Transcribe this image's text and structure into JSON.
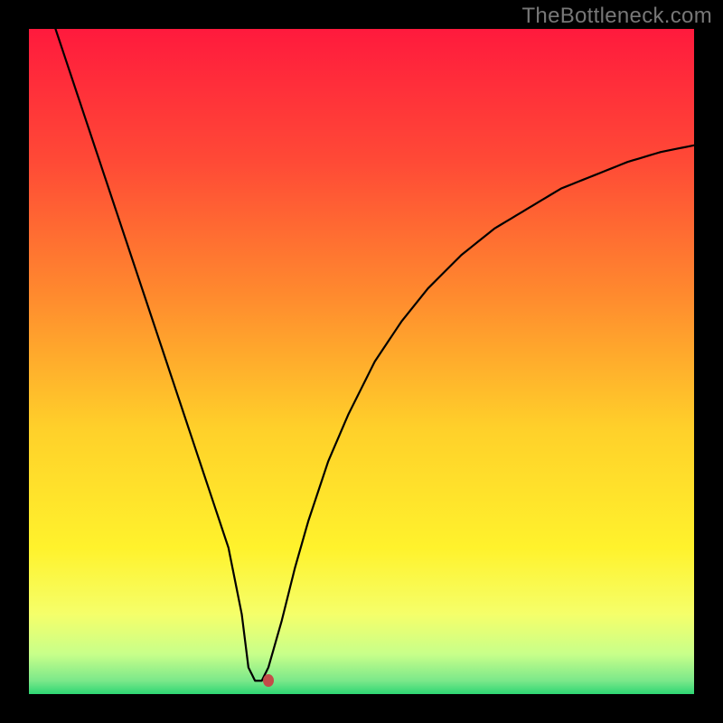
{
  "watermark": "TheBottleneck.com",
  "colors": {
    "frame_bg": "#000000",
    "gradient_stops": [
      {
        "offset": 0.0,
        "color": "#ff1a3d"
      },
      {
        "offset": 0.2,
        "color": "#ff4a36"
      },
      {
        "offset": 0.4,
        "color": "#ff8a2e"
      },
      {
        "offset": 0.6,
        "color": "#ffd02a"
      },
      {
        "offset": 0.78,
        "color": "#fff22c"
      },
      {
        "offset": 0.88,
        "color": "#f5ff6a"
      },
      {
        "offset": 0.94,
        "color": "#c8ff8a"
      },
      {
        "offset": 0.98,
        "color": "#7be88a"
      },
      {
        "offset": 1.0,
        "color": "#2ed673"
      }
    ],
    "curve_stroke": "#000000",
    "marker_fill": "#c44c49"
  },
  "chart_data": {
    "type": "line",
    "title": "",
    "xlabel": "",
    "ylabel": "",
    "xlim": [
      0,
      100
    ],
    "ylim": [
      0,
      100
    ],
    "grid": false,
    "legend": false,
    "series": [
      {
        "name": "bottleneck-curve",
        "x": [
          4,
          6,
          8,
          10,
          12,
          14,
          16,
          18,
          20,
          22,
          24,
          26,
          28,
          30,
          32,
          33,
          34,
          35,
          36,
          38,
          40,
          42,
          45,
          48,
          52,
          56,
          60,
          65,
          70,
          75,
          80,
          85,
          90,
          95,
          100
        ],
        "y": [
          100,
          94,
          88,
          82,
          76,
          70,
          64,
          58,
          52,
          46,
          40,
          34,
          28,
          22,
          12,
          4,
          2,
          2,
          4,
          11,
          19,
          26,
          35,
          42,
          50,
          56,
          61,
          66,
          70,
          73,
          76,
          78,
          80,
          81.5,
          82.5
        ]
      }
    ],
    "minimum_flat": {
      "x_range": [
        33.5,
        35.5
      ],
      "y": 2
    },
    "marker": {
      "x": 36,
      "y": 2
    },
    "annotations": [
      {
        "text": "TheBottleneck.com",
        "position": "top-right"
      }
    ]
  }
}
